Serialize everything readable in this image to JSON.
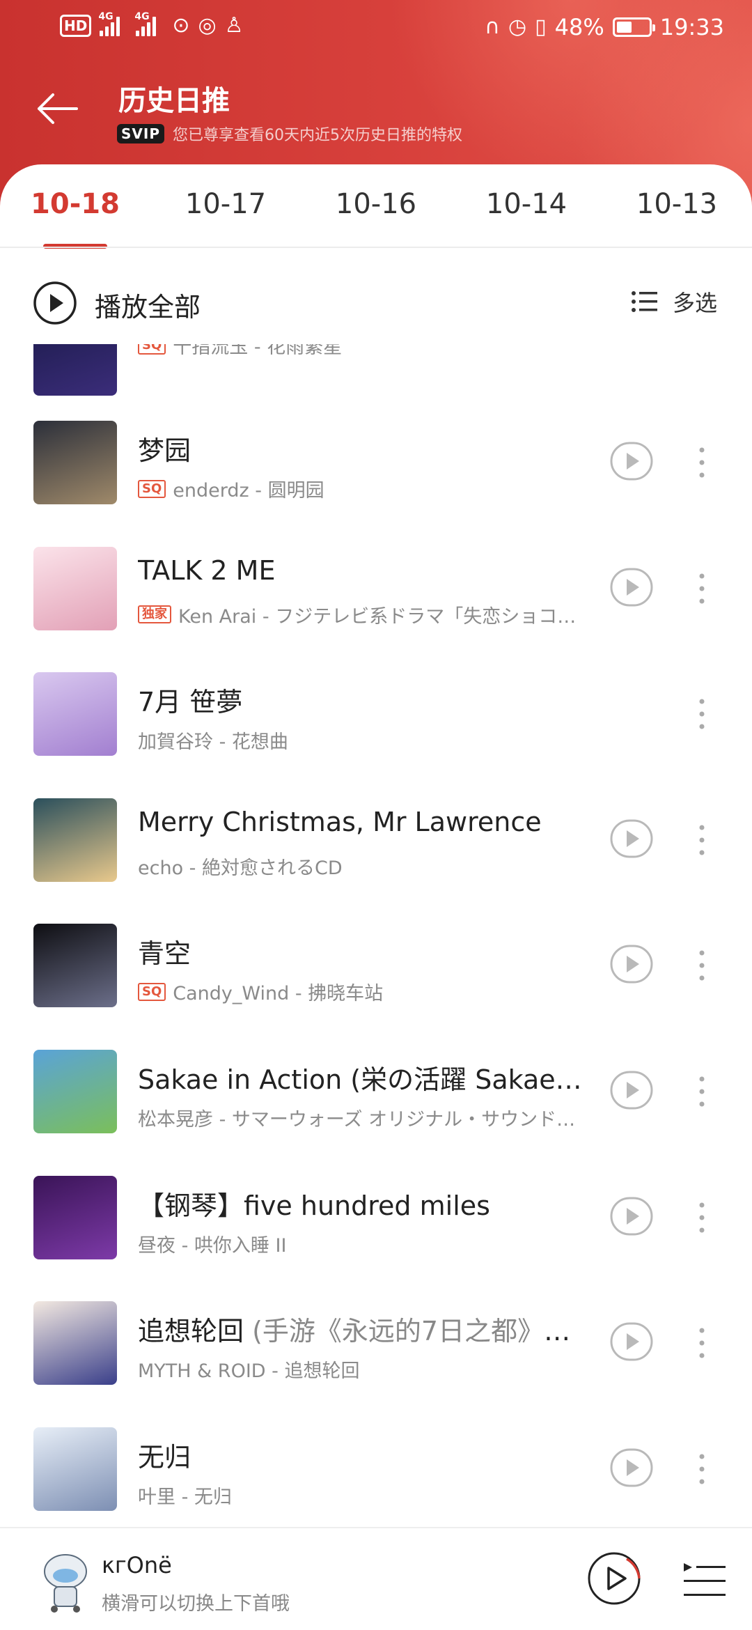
{
  "status_bar": {
    "hd": "HD",
    "net1": "4G",
    "net2": "4G",
    "battery_percent": "48%",
    "battery_level": 0.48,
    "time": "19:33"
  },
  "header": {
    "title": "历史日推",
    "vip_badge": "SVIP",
    "subtitle": "您已尊享查看60天内近5次历史日推的特权"
  },
  "tabs": [
    {
      "label": "10-18",
      "active": true
    },
    {
      "label": "10-17",
      "active": false
    },
    {
      "label": "10-16",
      "active": false
    },
    {
      "label": "10-14",
      "active": false
    },
    {
      "label": "10-13",
      "active": false
    }
  ],
  "toolbar": {
    "play_all_label": "播放全部",
    "multi_select_label": "多选"
  },
  "partial_song": {
    "badge": "SQ",
    "meta": "十指流玉 - 花雨繁星"
  },
  "songs": [
    {
      "title": "梦园",
      "alias": "",
      "badge": "SQ",
      "meta": "enderdz - 圆明园",
      "has_mv": true,
      "cover_colors": [
        "#2b2f3a",
        "#a08a6a"
      ]
    },
    {
      "title": "TALK 2 ME",
      "alias": "",
      "badge": "独家",
      "meta": "Ken Arai - フジテレビ系ドラマ「失恋ショコ…",
      "has_mv": true,
      "cover_colors": [
        "#fbe3ea",
        "#e2a0b6"
      ]
    },
    {
      "title": "7月 笹夢",
      "alias": "",
      "badge": "",
      "meta": "加賀谷玲 - 花想曲",
      "has_mv": false,
      "cover_colors": [
        "#d9c8ef",
        "#a27fd0"
      ]
    },
    {
      "title": "Merry Christmas, Mr Lawrence",
      "alias": "",
      "badge": "",
      "meta": "echo - 絶対愈されるCD",
      "has_mv": true,
      "cover_colors": [
        "#2a4f5c",
        "#e9c98c"
      ]
    },
    {
      "title": "青空",
      "alias": "",
      "badge": "SQ",
      "meta": "Candy_Wind - 拂晓车站",
      "has_mv": true,
      "cover_colors": [
        "#0e0e12",
        "#6c6f8a"
      ]
    },
    {
      "title": "Sakae in Action (栄の活躍 Sakae no…",
      "alias": "",
      "badge": "",
      "meta": "松本晃彦 - サマーウォーズ オリジナル・サウンド…",
      "has_mv": true,
      "cover_colors": [
        "#5aa3d8",
        "#7bbf5a"
      ]
    },
    {
      "title": "【钢琴】five hundred miles",
      "alias": "",
      "badge": "",
      "meta": "昼夜 - 哄你入睡 II",
      "has_mv": true,
      "cover_colors": [
        "#3a1457",
        "#7d3aa8"
      ]
    },
    {
      "title": "追想轮回",
      "alias": " (手游《永远的7日之都》主…",
      "badge": "",
      "meta": "MYTH & ROID - 追想轮回",
      "has_mv": true,
      "cover_colors": [
        "#f3e9e1",
        "#3a3f8a"
      ]
    },
    {
      "title": "无归",
      "alias": "",
      "badge": "",
      "meta": "叶里 - 无归",
      "has_mv": true,
      "cover_colors": [
        "#e7eef7",
        "#7d8fb3"
      ]
    }
  ],
  "mini_player": {
    "title": "κгOnë",
    "subtitle": "横滑可以切换上下首哦"
  },
  "colors": {
    "accent": "#d33a31",
    "header": "#d8413c",
    "badge": "#e4573d"
  }
}
